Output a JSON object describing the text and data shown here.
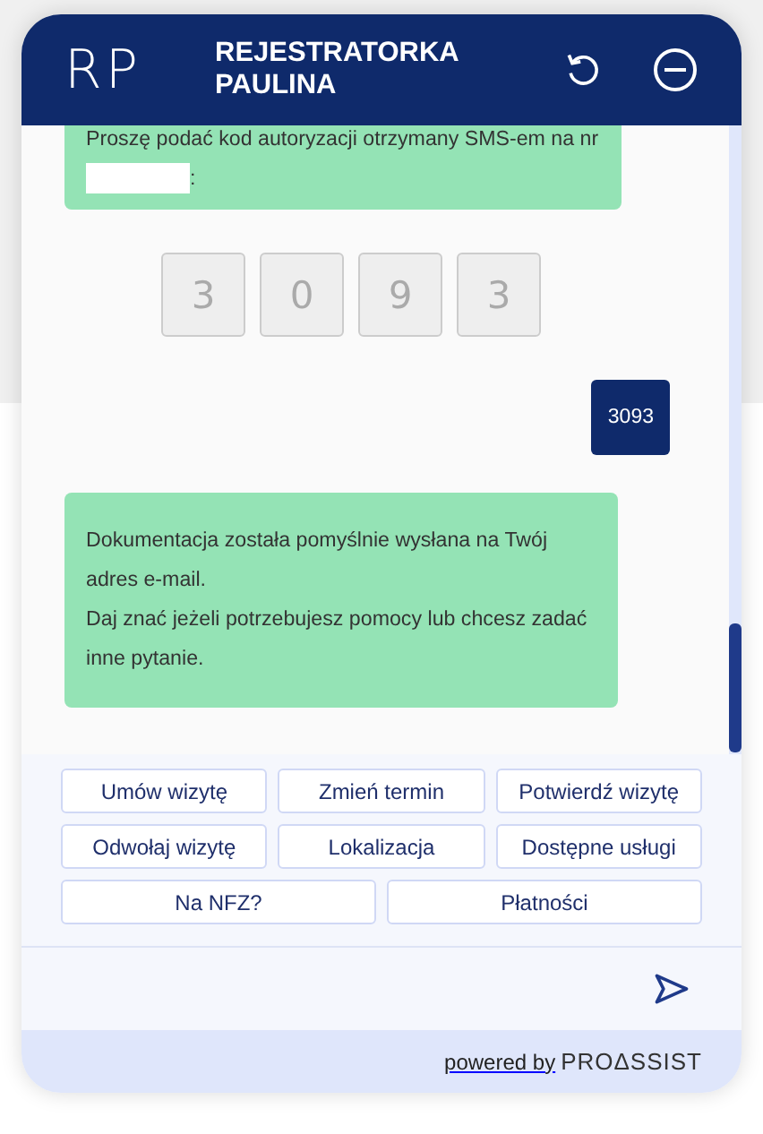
{
  "header": {
    "logo": "RP",
    "title": "REJESTRATORKA PAULINA"
  },
  "messages": [
    {
      "kind": "code_request",
      "text_before": "Proszę podać kod autoryzacji otrzymany SMS-em na nr",
      "redacted": true,
      "text_after": ":"
    },
    {
      "kind": "code_boxes",
      "digits": [
        "3",
        "0",
        "9",
        "3"
      ]
    },
    {
      "kind": "user_text",
      "lines": [
        "3093"
      ]
    },
    {
      "kind": "bot_text",
      "lines": [
        "Dokumentacja została pomyślnie wysłana na Twój adres e-mail.",
        "Daj znać jeżeli potrzebujesz pomocy lub chcesz zadać inne pytanie."
      ]
    }
  ],
  "quick_replies": [
    [
      "Umów wizytę",
      "Zmień termin",
      "Potwierdź wizytę"
    ],
    [
      "Odwołaj wizytę",
      "Lokalizacja",
      "Dostępne usługi"
    ],
    [
      "Na NFZ?",
      "Płatności"
    ]
  ],
  "footer": {
    "powered_by": "powered by",
    "brand": "PROΔSSIST"
  }
}
